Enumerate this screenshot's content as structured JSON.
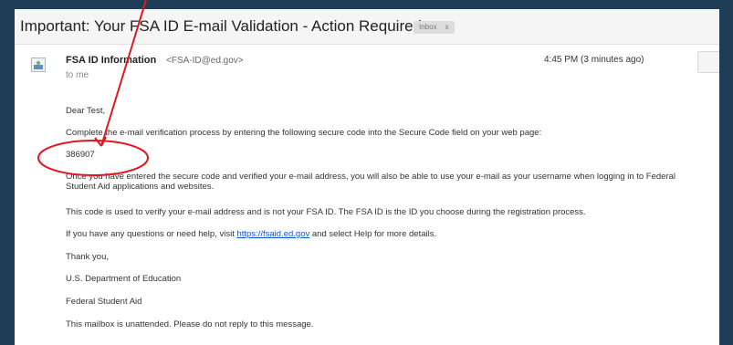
{
  "email": {
    "subject": "Important: Your FSA ID E-mail Validation - Action Required",
    "label_badge": "Inbox",
    "label_badge_close": "x",
    "sender_name": "FSA ID Information",
    "sender_email": "<FSA-ID@ed.gov>",
    "to": "to me",
    "timestamp": "4:45 PM (3 minutes ago)",
    "body": {
      "greeting": "Dear Test,",
      "instruction": "Complete the e-mail verification process by entering the following secure code into the Secure Code field on your web page:",
      "secure_code": "386907",
      "para_after_code": "Once you have entered the secure code and verified your e-mail address, you will also be able to use your e-mail as your username when logging in to Federal Student Aid applications and websites.",
      "verify_note": "This code is used to verify your e-mail address and is not your FSA ID. The FSA ID is the ID you choose during the registration process.",
      "help_prefix": "If you have any questions or need help, visit",
      "help_link": "https://fsaid.ed.gov",
      "help_suffix": "and select Help for more details.",
      "thanks": "Thank you,",
      "org_1": "U.S. Department of Education",
      "org_2": "Federal Student Aid",
      "footer": "This mailbox is unattended. Please do not reply to this message."
    }
  },
  "colors": {
    "background": "#1f3d57",
    "link": "#1155cc",
    "annotation": "#e0171f"
  },
  "icons": {
    "avatar": "default-avatar-icon"
  }
}
